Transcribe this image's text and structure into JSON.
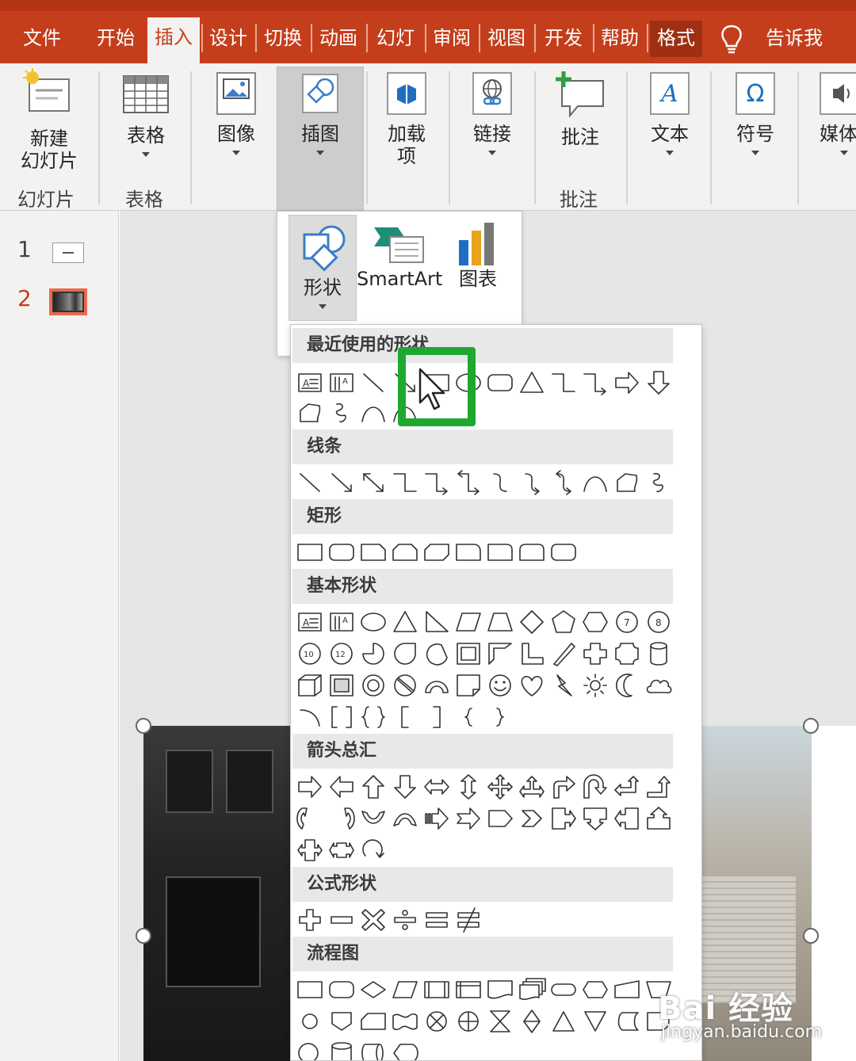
{
  "tabs": [
    {
      "label": "文件"
    },
    {
      "label": "开始"
    },
    {
      "label": "插入"
    },
    {
      "label": "设计"
    },
    {
      "label": "切换"
    },
    {
      "label": "动画"
    },
    {
      "label": "幻灯"
    },
    {
      "label": "审阅"
    },
    {
      "label": "视图"
    },
    {
      "label": "开发"
    },
    {
      "label": "帮助"
    },
    {
      "label": "格式"
    },
    {
      "label": "告诉我"
    }
  ],
  "ribbon": {
    "new_slide": "新建",
    "new_slide_2": "幻灯片",
    "slides_group": "幻灯片",
    "table": "表格",
    "table_group": "表格",
    "images": "图像",
    "illustrations": "插图",
    "addins": "加载",
    "addins_2": "项",
    "links": "链接",
    "comment": "批注",
    "comment_group": "批注",
    "text": "文本",
    "symbols": "符号",
    "media": "媒体"
  },
  "thumbnails": [
    {
      "number": "1"
    },
    {
      "number": "2"
    }
  ],
  "gallery": {
    "shapes": "形状",
    "smartart": "SmartArt",
    "chart": "图表"
  },
  "shape_sections": {
    "recent": "最近使用的形状",
    "lines": "线条",
    "rectangles": "矩形",
    "basic": "基本形状",
    "arrows": "箭头总汇",
    "equation": "公式形状",
    "flowchart": "流程图"
  },
  "watermark": {
    "brand": "Bai 经验",
    "url": "jingyan.baidu.com"
  },
  "colors": {
    "accent": "#c43e1c",
    "highlight": "#1ea830"
  }
}
